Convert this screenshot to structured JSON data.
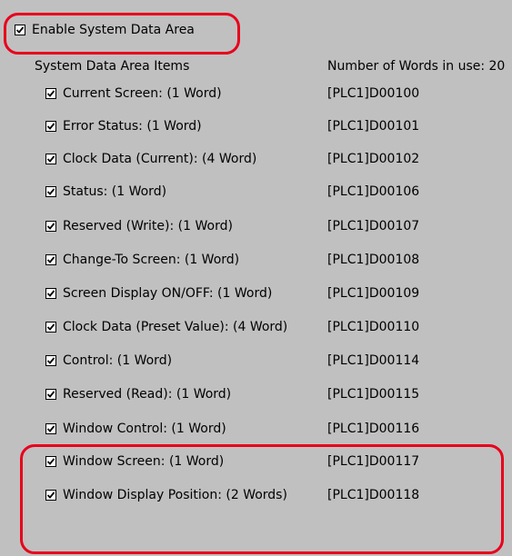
{
  "enable": {
    "label": "Enable System Data Area",
    "checked": true
  },
  "header": {
    "items_label": "System Data Area Items",
    "words_label": "Number of Words in use: 20"
  },
  "items": [
    {
      "label": "Current Screen: (1 Word)",
      "address": "[PLC1]D00100",
      "checked": true
    },
    {
      "label": "Error Status: (1 Word)",
      "address": "[PLC1]D00101",
      "checked": true
    },
    {
      "label": "Clock Data (Current): (4 Word)",
      "address": "[PLC1]D00102",
      "checked": true
    },
    {
      "label": "Status: (1 Word)",
      "address": "[PLC1]D00106",
      "checked": true
    },
    {
      "label": "Reserved (Write): (1 Word)",
      "address": "[PLC1]D00107",
      "checked": true
    },
    {
      "label": "Change-To Screen: (1 Word)",
      "address": "[PLC1]D00108",
      "checked": true
    },
    {
      "label": "Screen Display ON/OFF: (1 Word)",
      "address": "[PLC1]D00109",
      "checked": true
    },
    {
      "label": "Clock Data (Preset Value): (4 Word)",
      "address": "[PLC1]D00110",
      "checked": true
    },
    {
      "label": "Control: (1 Word)",
      "address": "[PLC1]D00114",
      "checked": true
    },
    {
      "label": "Reserved (Read): (1 Word)",
      "address": "[PLC1]D00115",
      "checked": true
    },
    {
      "label": "Window Control: (1 Word)",
      "address": "[PLC1]D00116",
      "checked": true
    },
    {
      "label": "Window Screen: (1 Word)",
      "address": "[PLC1]D00117",
      "checked": true
    },
    {
      "label": "Window Display Position: (2 Words)",
      "address": "[PLC1]D00118",
      "checked": true
    }
  ],
  "colors": {
    "panel_bg": "#c0c0c0",
    "highlight": "#e8001c"
  },
  "icons": {
    "checkbox": "checkmark-icon"
  }
}
